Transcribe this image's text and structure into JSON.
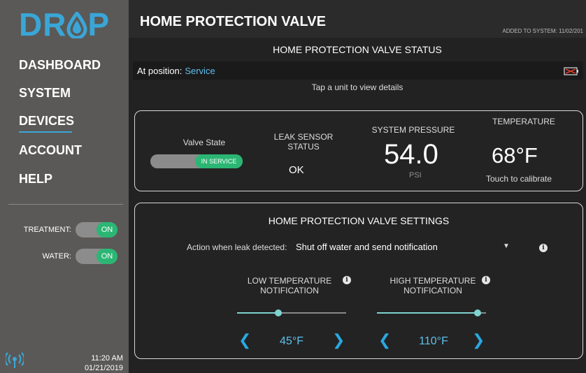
{
  "logo": {
    "text_left": "DR",
    "text_right": "P"
  },
  "nav": {
    "items": [
      {
        "label": "DASHBOARD"
      },
      {
        "label": "SYSTEM"
      },
      {
        "label": "DEVICES"
      },
      {
        "label": "ACCOUNT"
      },
      {
        "label": "HELP"
      }
    ],
    "active": "DEVICES"
  },
  "side_toggles": {
    "treatment": {
      "label": "TREATMENT:",
      "state": "ON"
    },
    "water": {
      "label": "WATER:",
      "state": "ON"
    }
  },
  "clock": {
    "time": "11:20 AM",
    "date": "01/21/2019"
  },
  "header": {
    "title": "HOME PROTECTION VALVE",
    "meta": "ADDED TO SYSTEM: 11/02/201"
  },
  "status": {
    "title": "HOME PROTECTION VALVE STATUS",
    "position_label": "At position:",
    "position_value": "Service",
    "tap_hint": "Tap a unit to view details"
  },
  "status_panel": {
    "valve_state_label": "Valve State",
    "valve_toggle_text": "IN SERVICE",
    "leak_label_line1": "LEAK SENSOR",
    "leak_label_line2": "STATUS",
    "leak_value": "OK",
    "pressure_label": "SYSTEM PRESSURE",
    "pressure_value": "54.0",
    "pressure_unit": "PSI",
    "temp_label": "TEMPERATURE",
    "temp_value": "68°F",
    "temp_sub": "Touch to calibrate"
  },
  "settings": {
    "title": "HOME PROTECTION VALVE SETTINGS",
    "action_label": "Action when leak detected:",
    "action_value": "Shut off water and send notification",
    "low": {
      "label_line1": "LOW TEMPERATURE",
      "label_line2": "NOTIFICATION",
      "value": "45°F",
      "slider_fraction": 0.38
    },
    "high": {
      "label_line1": "HIGH TEMPERATURE",
      "label_line2": "NOTIFICATION",
      "value": "110°F",
      "slider_fraction": 0.92
    }
  },
  "icons": {
    "info": "info-icon",
    "battery": "battery-empty-icon",
    "signal": "signal-icon",
    "chevron_left": "chevron-left-icon",
    "chevron_right": "chevron-right-icon",
    "caret": "caret-down-icon"
  },
  "colors": {
    "accent": "#3aa6d8",
    "on": "#2bb673",
    "slider": "#7fd3cf",
    "alert": "#e03a2f"
  }
}
